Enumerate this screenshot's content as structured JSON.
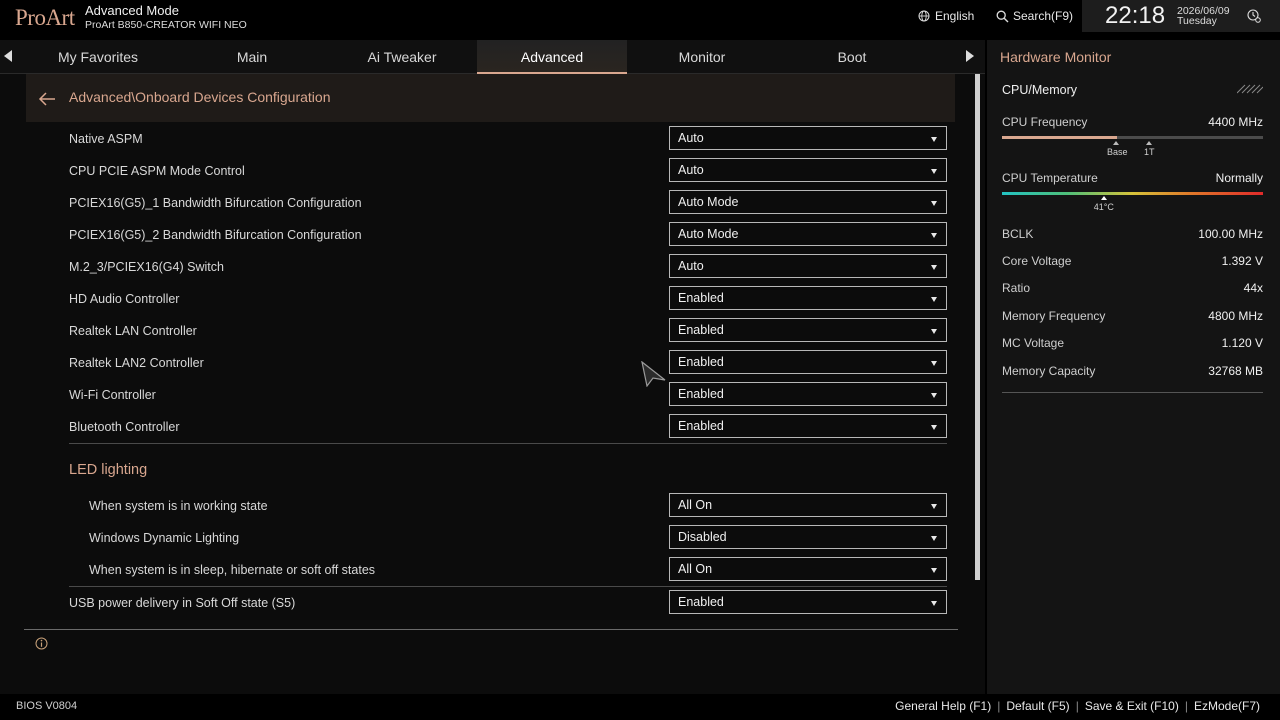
{
  "header": {
    "logo": "ProArt",
    "mode": "Advanced Mode",
    "board": "ProArt B850-CREATOR WIFI NEO",
    "language": "English",
    "search": "Search(F9)",
    "time": "22:18",
    "date": "2026/06/09",
    "weekday": "Tuesday"
  },
  "tabs": [
    {
      "label": "My Favorites"
    },
    {
      "label": "Main"
    },
    {
      "label": "Ai Tweaker"
    },
    {
      "label": "Advanced",
      "active": true
    },
    {
      "label": "Monitor"
    },
    {
      "label": "Boot"
    }
  ],
  "breadcrumb": "Advanced\\Onboard Devices Configuration",
  "settings": [
    {
      "label": "Native ASPM",
      "value": "Auto"
    },
    {
      "label": "CPU PCIE ASPM Mode Control",
      "value": "Auto"
    },
    {
      "label": "PCIEX16(G5)_1 Bandwidth Bifurcation Configuration",
      "value": "Auto Mode"
    },
    {
      "label": "PCIEX16(G5)_2 Bandwidth Bifurcation Configuration",
      "value": "Auto Mode"
    },
    {
      "label": "M.2_3/PCIEX16(G4) Switch",
      "value": "Auto"
    },
    {
      "label": "HD Audio Controller",
      "value": "Enabled"
    },
    {
      "label": "Realtek LAN Controller",
      "value": "Enabled"
    },
    {
      "label": "Realtek LAN2 Controller",
      "value": "Enabled"
    },
    {
      "label": "Wi-Fi Controller",
      "value": "Enabled"
    },
    {
      "label": "Bluetooth Controller",
      "value": "Enabled"
    }
  ],
  "led": {
    "title": "LED lighting",
    "items": [
      {
        "label": "When system is in working state",
        "value": "All On"
      },
      {
        "label": "Windows Dynamic Lighting",
        "value": "Disabled"
      },
      {
        "label": "When system is in sleep, hibernate or soft off states",
        "value": "All On"
      }
    ]
  },
  "usb": {
    "label": "USB power delivery in Soft Off state (S5)",
    "value": "Enabled"
  },
  "hw": {
    "title": "Hardware Monitor",
    "section": "CPU/Memory",
    "cpu_freq": {
      "label": "CPU Frequency",
      "value": "4400 MHz",
      "fill_fraction": 0.44,
      "base_label": "Base",
      "turbo_label": "1T"
    },
    "cpu_temp": {
      "label": "CPU Temperature",
      "value": "Normally",
      "marker_label": "41°C",
      "marker_fraction": 0.39
    },
    "rows": [
      {
        "label": "BCLK",
        "value": "100.00 MHz"
      },
      {
        "label": "Core Voltage",
        "value": "1.392 V"
      },
      {
        "label": "Ratio",
        "value": "44x"
      },
      {
        "label": "Memory Frequency",
        "value": "4800 MHz"
      },
      {
        "label": "MC Voltage",
        "value": "1.120 V"
      },
      {
        "label": "Memory Capacity",
        "value": "32768 MB"
      }
    ]
  },
  "footer": {
    "bios": "BIOS V0804",
    "help": "General Help (F1)",
    "default": "Default (F5)",
    "save": "Save & Exit (F10)",
    "ez": "EzMode(F7)"
  },
  "colors": {
    "accent": "#d9a78f",
    "background": "#000000",
    "panel": "#141414"
  }
}
